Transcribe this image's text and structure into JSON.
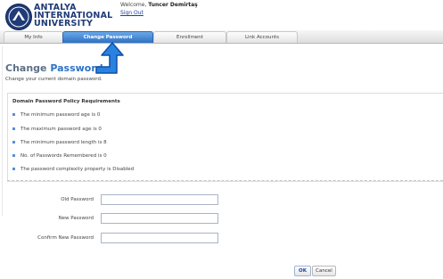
{
  "header": {
    "brand_line1": "ANTALYA",
    "brand_line2": "INTERNATIONAL",
    "brand_line3": "UNIVERSITY",
    "welcome_prefix": "Welcome,",
    "user_name": "Tuncer Demirtaş",
    "signout_label": "Sign Out",
    "logo_icon": "university-seal-icon",
    "brand_color": "#1f3b78"
  },
  "tabs": [
    {
      "label": "My Info",
      "active": false
    },
    {
      "label": "Change Password",
      "active": true
    },
    {
      "label": "Enrollment",
      "active": false
    },
    {
      "label": "Link Accounts",
      "active": false
    }
  ],
  "page": {
    "title_part1": "Change",
    "title_part2": "Password",
    "description": "Change your current domain password."
  },
  "policy": {
    "title": "Domain Password Policy Requirements",
    "items": [
      "The minimum password age is 0",
      "The maximum password age is 0",
      "The minimum password length is 8",
      "No. of Passwords Remembered is 0",
      "The password complexity property is Disabled"
    ]
  },
  "form": {
    "old_password_label": "Old Password",
    "new_password_label": "New Password",
    "confirm_password_label": "Confirm New Password",
    "old_password_value": "",
    "new_password_value": "",
    "confirm_password_value": ""
  },
  "buttons": {
    "ok_label": "OK",
    "cancel_label": "Cancel"
  },
  "colors": {
    "accent": "#2f72c4",
    "arrow": "#1e6fd0"
  }
}
